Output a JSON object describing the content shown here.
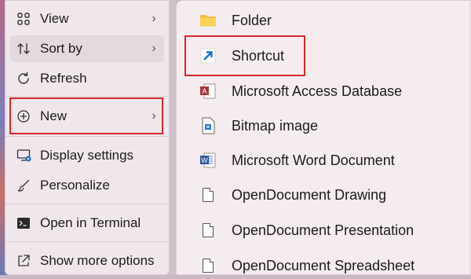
{
  "left_menu": {
    "items": [
      {
        "label": "View",
        "icon": "grid-view-icon",
        "has_submenu": true
      },
      {
        "label": "Sort by",
        "icon": "sort-icon",
        "has_submenu": true
      },
      {
        "label": "Refresh",
        "icon": "refresh-icon",
        "has_submenu": false
      },
      {
        "label": "New",
        "icon": "plus-circle-icon",
        "has_submenu": true
      },
      {
        "label": "Display settings",
        "icon": "display-settings-icon",
        "has_submenu": false
      },
      {
        "label": "Personalize",
        "icon": "brush-icon",
        "has_submenu": false
      },
      {
        "label": "Open in Terminal",
        "icon": "terminal-icon",
        "has_submenu": false
      },
      {
        "label": "Show more options",
        "icon": "share-icon",
        "has_submenu": false
      }
    ],
    "submenu_chevron": "›"
  },
  "right_menu": {
    "items": [
      {
        "label": "Folder",
        "icon": "folder-icon"
      },
      {
        "label": "Shortcut",
        "icon": "shortcut-arrow-icon"
      },
      {
        "label": "Microsoft Access Database",
        "icon": "access-icon"
      },
      {
        "label": "Bitmap image",
        "icon": "bitmap-icon"
      },
      {
        "label": "Microsoft Word Document",
        "icon": "word-icon"
      },
      {
        "label": "OpenDocument Drawing",
        "icon": "document-icon"
      },
      {
        "label": "OpenDocument Presentation",
        "icon": "document-icon"
      },
      {
        "label": "OpenDocument Spreadsheet",
        "icon": "document-icon"
      }
    ]
  },
  "colors": {
    "highlight": "#d7262d",
    "menu_bg": "#f0e7ec",
    "accent_blue": "#1a6fc9"
  }
}
